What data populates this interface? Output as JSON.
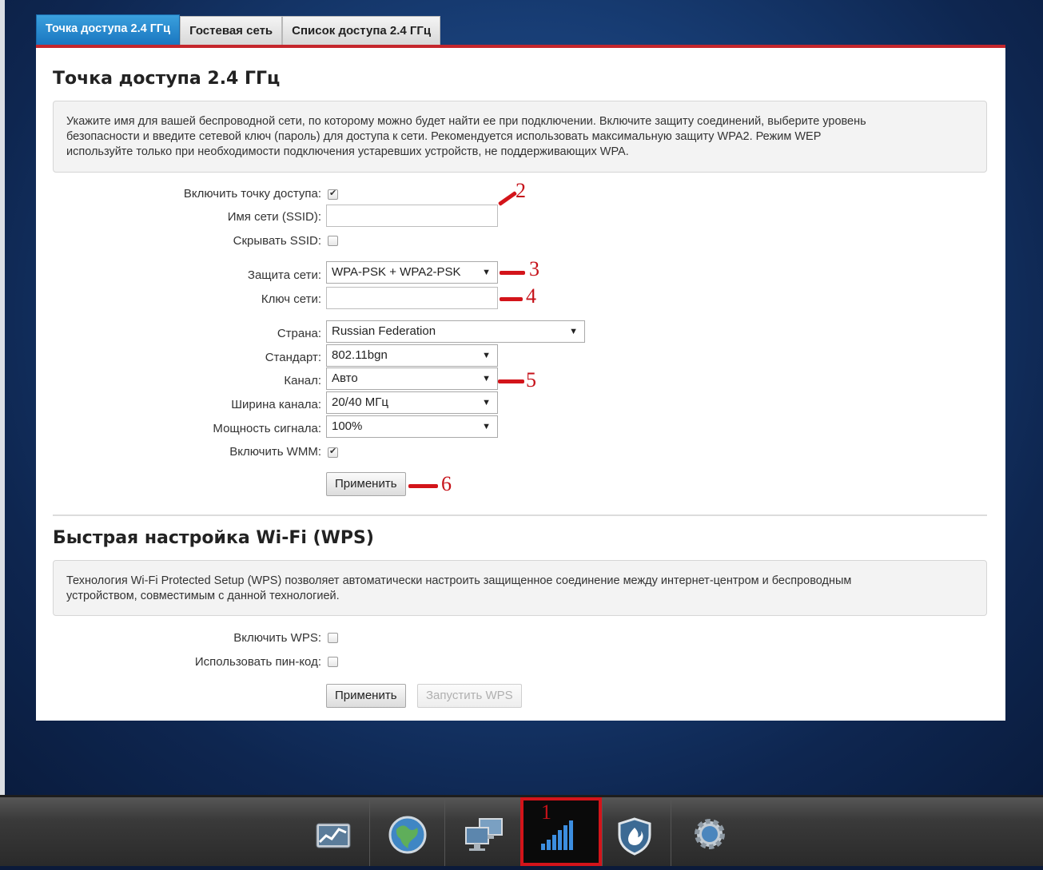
{
  "tabs": [
    {
      "label": "Точка доступа 2.4 ГГц",
      "active": true
    },
    {
      "label": "Гостевая сеть",
      "active": false
    },
    {
      "label": "Список доступа 2.4 ГГц",
      "active": false
    }
  ],
  "ap_section": {
    "title": "Точка доступа 2.4 ГГц",
    "info_lines": [
      "Укажите имя для вашей беспроводной сети, по которому можно будет найти ее при подключении. Включите защиту соединений, выберите уровень",
      "безопасности и введите сетевой ключ (пароль) для доступа к сети. Рекомендуется использовать максимальную защиту WPA2. Режим WEP",
      "используйте только при необходимости подключения устаревших устройств, не поддерживающих WPA."
    ],
    "enable_ap_label": "Включить точку доступа:",
    "ssid_label": "Имя сети (SSID):",
    "ssid_value": "",
    "hide_ssid_label": "Скрывать SSID:",
    "security_label": "Защита сети:",
    "security_value": "WPA-PSK + WPA2-PSK",
    "key_label": "Ключ сети:",
    "key_value": "",
    "country_label": "Страна:",
    "country_value": "Russian Federation",
    "standard_label": "Стандарт:",
    "standard_value": "802.11bgn",
    "channel_label": "Канал:",
    "channel_value": "Авто",
    "width_label": "Ширина канала:",
    "width_value": "20/40 МГц",
    "power_label": "Мощность сигнала:",
    "power_value": "100%",
    "wmm_label": "Включить WMM:",
    "apply_label": "Применить"
  },
  "wps_section": {
    "title": "Быстрая настройка Wi-Fi (WPS)",
    "info_lines": [
      "Технология Wi-Fi Protected Setup (WPS) позволяет автоматически настроить защищенное соединение между интернет-центром и беспроводным",
      "устройством, совместимым с данной технологией."
    ],
    "enable_label": "Включить WPS:",
    "pin_label": "Использовать пин-код:",
    "apply_label": "Применить",
    "start_label": "Запустить WPS"
  },
  "annotations": [
    "1",
    "2",
    "3",
    "4",
    "5",
    "6"
  ],
  "checkbox_states": {
    "enable_ap": true,
    "hide_ssid": false,
    "wmm": true,
    "wps": false,
    "pin": false
  },
  "colors": {
    "accent_red": "#c5262c",
    "tab_active": "#1a76c0",
    "annotation": "#d3141a"
  },
  "bottom_nav": [
    {
      "icon": "monitoring-chart-icon"
    },
    {
      "icon": "internet-globe-icon"
    },
    {
      "icon": "home-network-computers-icon"
    },
    {
      "icon": "wifi-signal-bars-icon",
      "selected": true
    },
    {
      "icon": "security-shield-icon"
    },
    {
      "icon": "settings-gear-icon"
    }
  ]
}
